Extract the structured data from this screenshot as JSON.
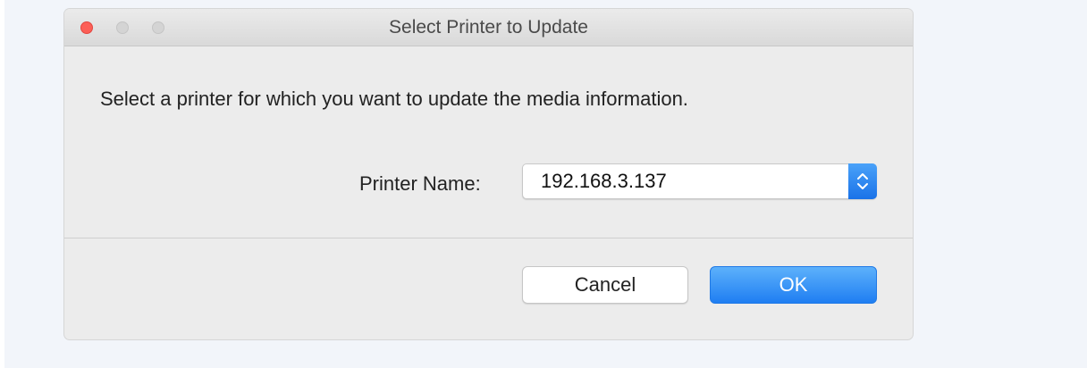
{
  "window": {
    "title": "Select Printer to Update"
  },
  "dialog": {
    "message": "Select a printer for which you want to update the media information.",
    "printer_label": "Printer Name:",
    "printer_value": "192.168.3.137"
  },
  "buttons": {
    "cancel": "Cancel",
    "ok": "OK"
  },
  "colors": {
    "accent": "#1f7ef2",
    "close": "#fc5f57"
  },
  "icons": {
    "select_arrows": "chevron-up-down-icon"
  }
}
